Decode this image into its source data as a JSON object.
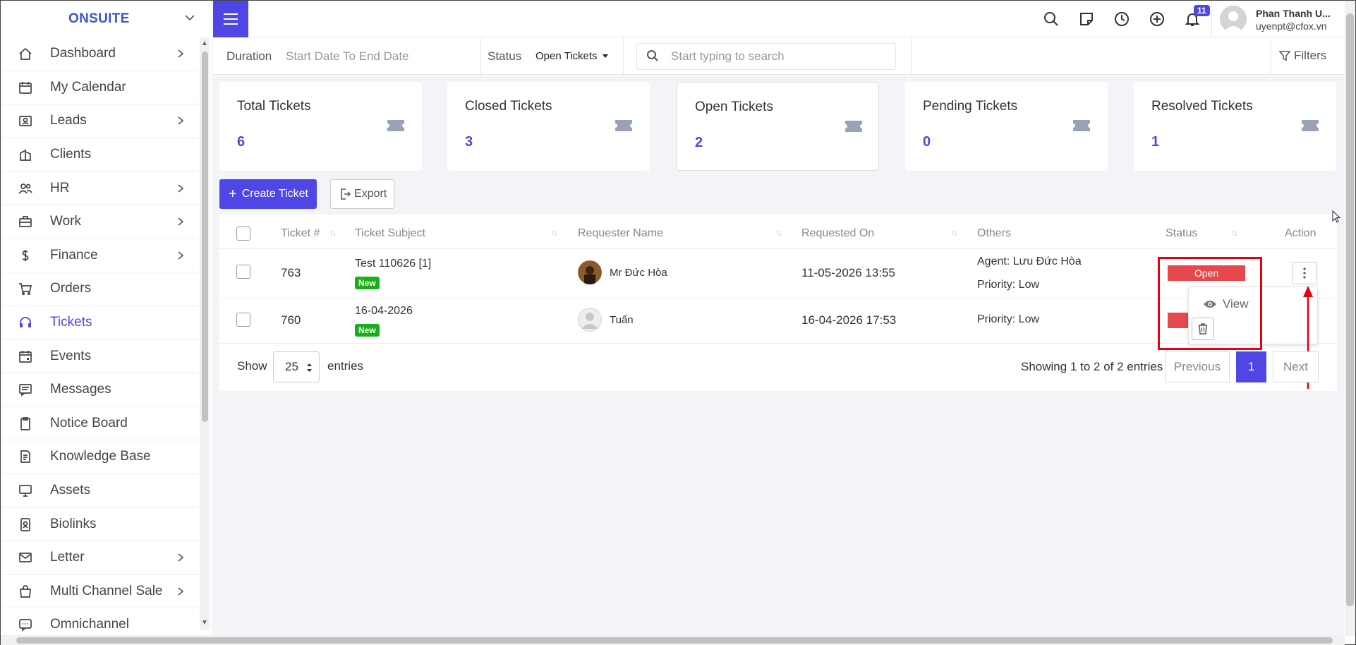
{
  "brand": "ONSUITE",
  "sidebar": {
    "items": [
      {
        "label": "Dashboard",
        "icon": "home-icon",
        "arrow": true
      },
      {
        "label": "My Calendar",
        "icon": "calendar-icon",
        "arrow": false
      },
      {
        "label": "Leads",
        "icon": "contact-card-icon",
        "arrow": true
      },
      {
        "label": "Clients",
        "icon": "building-icon",
        "arrow": false
      },
      {
        "label": "HR",
        "icon": "people-icon",
        "arrow": true
      },
      {
        "label": "Work",
        "icon": "briefcase-icon",
        "arrow": true
      },
      {
        "label": "Finance",
        "icon": "dollar-icon",
        "arrow": true
      },
      {
        "label": "Orders",
        "icon": "cart-icon",
        "arrow": false
      },
      {
        "label": "Tickets",
        "icon": "headset-icon",
        "arrow": false,
        "active": true
      },
      {
        "label": "Events",
        "icon": "calendar-event-icon",
        "arrow": false
      },
      {
        "label": "Messages",
        "icon": "message-icon",
        "arrow": false
      },
      {
        "label": "Notice Board",
        "icon": "clipboard-icon",
        "arrow": false
      },
      {
        "label": "Knowledge Base",
        "icon": "document-icon",
        "arrow": false
      },
      {
        "label": "Assets",
        "icon": "monitor-icon",
        "arrow": false
      },
      {
        "label": "Biolinks",
        "icon": "id-badge-icon",
        "arrow": false
      },
      {
        "label": "Letter",
        "icon": "envelope-icon",
        "arrow": true
      },
      {
        "label": "Multi Channel Sale",
        "icon": "bag-icon",
        "arrow": true
      },
      {
        "label": "Omnichannel",
        "icon": "chat-icon",
        "arrow": false
      }
    ]
  },
  "topbar": {
    "notification_count": "11",
    "user_name": "Phan Thanh U...",
    "user_email": "uyenpt@cfox.vn"
  },
  "filterbar": {
    "duration_label": "Duration",
    "date_placeholder": "Start Date To End Date",
    "status_label": "Status",
    "status_value": "Open Tickets",
    "search_placeholder": "Start typing to search",
    "filters_label": "Filters"
  },
  "cards": [
    {
      "title": "Total Tickets",
      "value": "6"
    },
    {
      "title": "Closed Tickets",
      "value": "3"
    },
    {
      "title": "Open Tickets",
      "value": "2"
    },
    {
      "title": "Pending Tickets",
      "value": "0"
    },
    {
      "title": "Resolved Tickets",
      "value": "1"
    }
  ],
  "actions": {
    "create": "Create Ticket",
    "export": "Export"
  },
  "table": {
    "headers": [
      "Ticket #",
      "Ticket Subject",
      "Requester Name",
      "Requested On",
      "Others",
      "Status",
      "Action"
    ],
    "rows": [
      {
        "id": "763",
        "subject": "Test 110626 [1]",
        "badge": "New",
        "requester": "Mr Đức Hòa",
        "requested_on": "11-05-2026 13:55",
        "agent": "Agent: Lưu Đức Hòa",
        "priority": "Priority: Low",
        "status": "Open"
      },
      {
        "id": "760",
        "subject": "16-04-2026",
        "badge": "New",
        "requester": "Tuấn",
        "requested_on": "16-04-2026 17:53",
        "priority": "Priority: Low",
        "status": ""
      }
    ]
  },
  "dropdown": {
    "view_label": "View"
  },
  "footer": {
    "show": "Show",
    "page_size": "25",
    "entries": "entries",
    "showing": "Showing 1 to 2 of 2 entries",
    "previous": "Previous",
    "current_page": "1",
    "next": "Next"
  },
  "colors": {
    "accent": "#4f46e5",
    "open_status": "#e5484d",
    "new_badge": "#1aaf1a",
    "highlight": "#e8000e"
  }
}
